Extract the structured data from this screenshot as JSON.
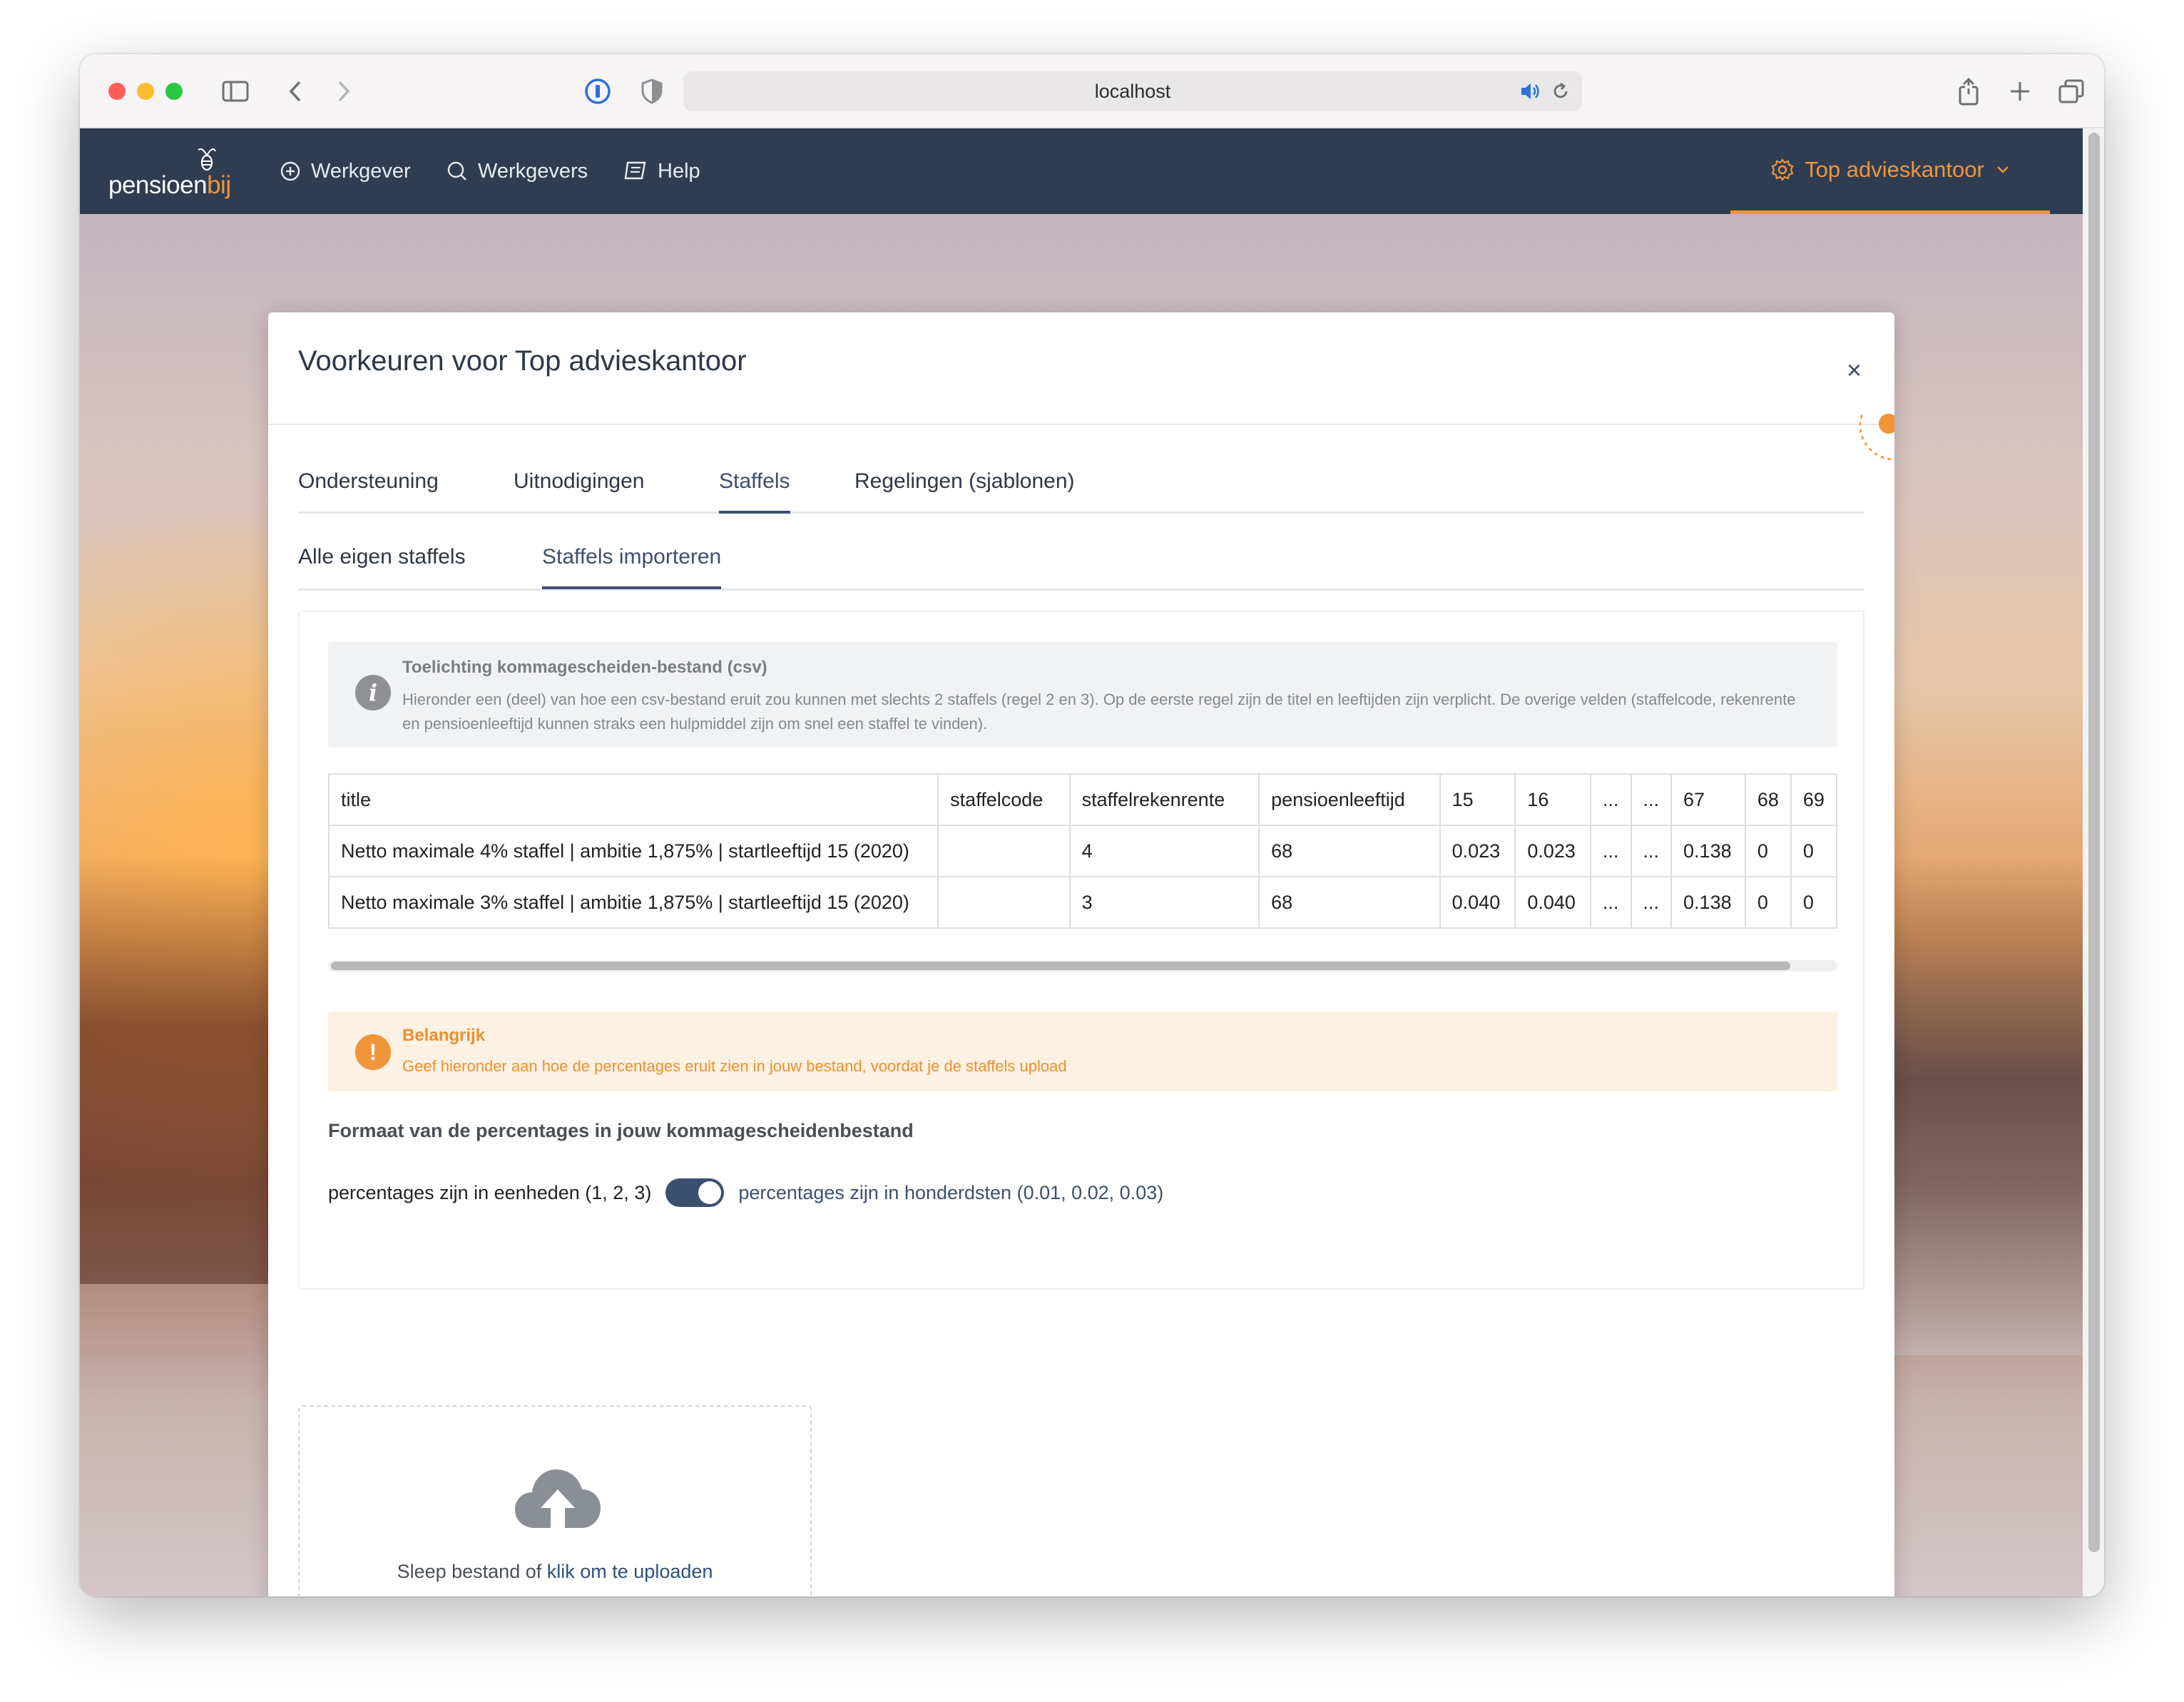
{
  "browser": {
    "url": "localhost"
  },
  "navbar": {
    "brand_main": "pensioen",
    "brand_accent": "bij",
    "items": [
      {
        "label": "Werkgever",
        "icon": "plus-circle-icon"
      },
      {
        "label": "Werkgevers",
        "icon": "search-icon"
      },
      {
        "label": "Help",
        "icon": "book-icon"
      }
    ],
    "account_label": "Top advieskantoor"
  },
  "modal": {
    "title": "Voorkeuren voor Top advieskantoor",
    "close_label": "×",
    "tabs": [
      {
        "label": "Ondersteuning",
        "active": false
      },
      {
        "label": "Uitnodigingen",
        "active": false
      },
      {
        "label": "Staffels",
        "active": true
      },
      {
        "label": "Regelingen (sjablonen)",
        "active": false
      }
    ],
    "subtabs": [
      {
        "label": "Alle eigen staffels",
        "active": false
      },
      {
        "label": "Staffels importeren",
        "active": true
      }
    ]
  },
  "info": {
    "icon": "info-icon",
    "title": "Toelichting kommagescheiden-bestand (csv)",
    "text": "Hieronder een (deel) van hoe een csv-bestand eruit zou kunnen met slechts 2 staffels (regel 2 en 3). Op de eerste regel zijn de titel en leeftijden zijn verplicht. De overige velden (staffelcode, rekenrente en pensioenleeftijd kunnen straks een hulpmiddel zijn om snel een staffel te vinden)."
  },
  "csv_table": {
    "headers": [
      "title",
      "staffelcode",
      "staffelrekenrente",
      "pensioenleeftijd",
      "15",
      "16",
      "...",
      "...",
      "67",
      "68",
      "69"
    ],
    "rows": [
      [
        "Netto maximale 4% staffel | ambitie 1,875% | startleeftijd 15 (2020)",
        "",
        "4",
        "68",
        "0.023",
        "0.023",
        "...",
        "...",
        "0.138",
        "0",
        "0"
      ],
      [
        "Netto maximale 3% staffel | ambitie 1,875% | startleeftijd 15 (2020)",
        "",
        "3",
        "68",
        "0.040",
        "0.040",
        "...",
        "...",
        "0.138",
        "0",
        "0"
      ]
    ]
  },
  "warning": {
    "icon": "exclamation-icon",
    "title": "Belangrijk",
    "text": "Geef hieronder aan hoe de percentages eruit zien in jouw bestand, voordat je de staffels upload"
  },
  "format": {
    "label": "Formaat van de percentages in jouw kommagescheidenbestand",
    "left_option": "percentages zijn in eenheden (1, 2, 3)",
    "right_option": "percentages zijn in honderdsten (0.01, 0.02, 0.03)",
    "toggle_on": true
  },
  "upload": {
    "icon": "cloud-upload-icon",
    "text": "Sleep bestand of",
    "link": "klik om te uploaden"
  },
  "colors": {
    "navbar": "#2f3d52",
    "accent": "#f0953a",
    "primary": "#3b4f70"
  }
}
